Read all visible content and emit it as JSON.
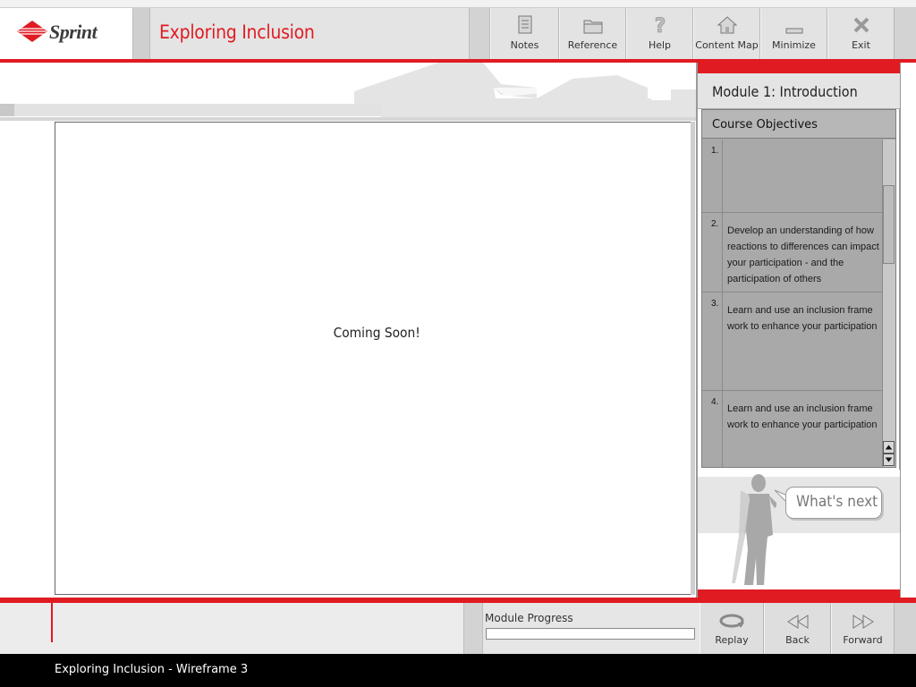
{
  "header": {
    "logo_text": "Sprint",
    "course_title": "Exploring Inclusion",
    "tools": [
      {
        "label": "Notes",
        "icon": "notes-icon"
      },
      {
        "label": "Reference",
        "icon": "folder-icon"
      },
      {
        "label": "Help",
        "icon": "question-icon"
      },
      {
        "label": "Content Map",
        "icon": "house-icon"
      },
      {
        "label": "Minimize",
        "icon": "minimize-icon"
      },
      {
        "label": "Exit",
        "icon": "close-icon"
      }
    ]
  },
  "content": {
    "message": "Coming Soon!"
  },
  "side_panel": {
    "module_title": "Module 1: Introduction",
    "objectives_header": "Course Objectives",
    "objectives": [
      {
        "num": "1.",
        "text": ""
      },
      {
        "num": "2.",
        "text": "Develop an understanding of how reactions to differences can impact your participation - and the participation of others"
      },
      {
        "num": "3.",
        "text": "Learn and use an inclusion frame work to enhance your participation"
      },
      {
        "num": "4.",
        "text": "Learn and use an inclusion frame work to enhance your participation"
      }
    ],
    "whats_next_label": "What's next"
  },
  "footer": {
    "progress_label": "Module Progress",
    "progress_fraction": 0,
    "buttons": [
      {
        "label": "Replay",
        "icon": "replay-icon"
      },
      {
        "label": "Back",
        "icon": "rewind-icon"
      },
      {
        "label": "Forward",
        "icon": "fast-forward-icon"
      }
    ],
    "status_text": "Exploring Inclusion - Wireframe 3"
  },
  "colors": {
    "accent_red": "#e01b22",
    "panel_gray": "#a9a9a9",
    "status_bar": "#000000"
  }
}
